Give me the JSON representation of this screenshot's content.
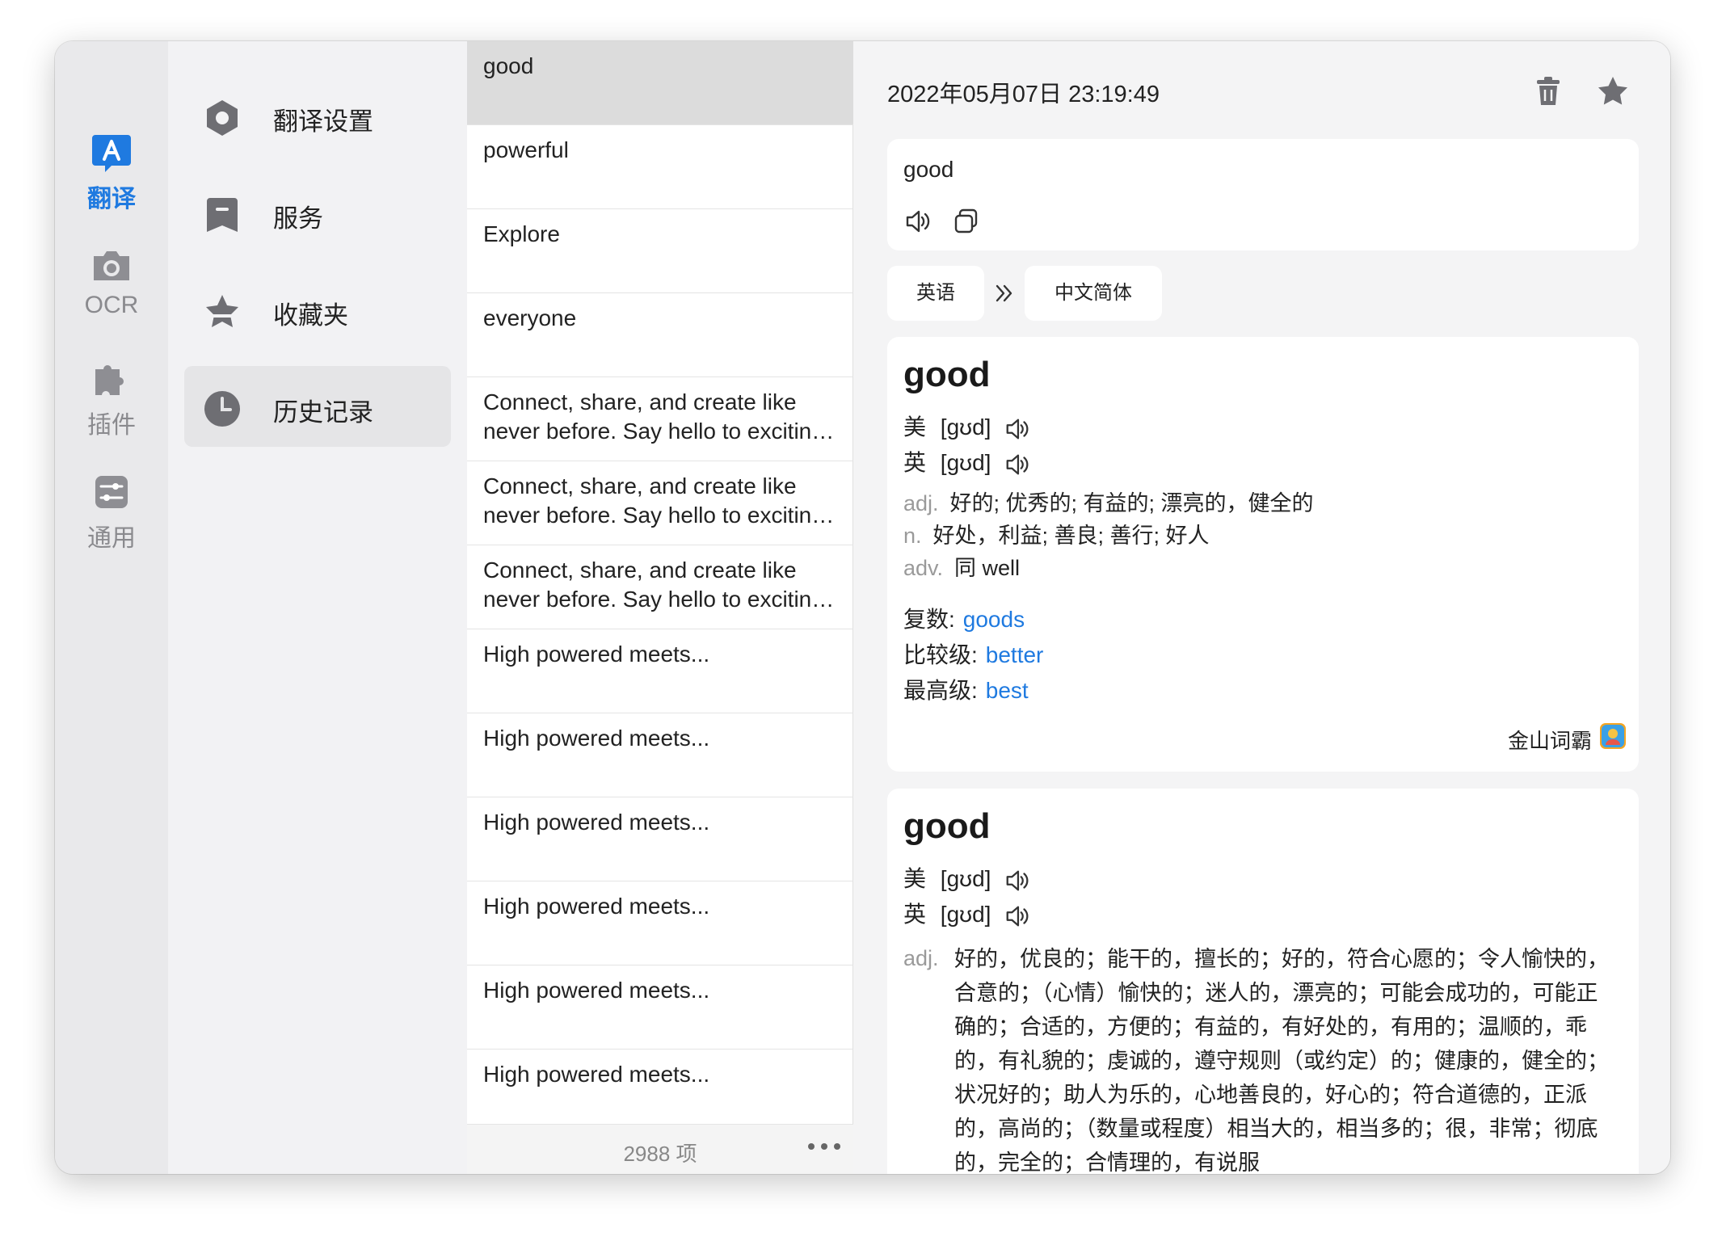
{
  "window": {
    "rail": [
      {
        "label": "翻译",
        "icon": "translate-icon",
        "active": true
      },
      {
        "label": "OCR",
        "icon": "camera-icon",
        "active": false
      },
      {
        "label": "插件",
        "icon": "puzzle-icon",
        "active": false
      },
      {
        "label": "通用",
        "icon": "sliders-icon",
        "active": false
      }
    ],
    "menu": [
      {
        "label": "翻译设置",
        "icon": "settings-ring-icon"
      },
      {
        "label": "服务",
        "icon": "service-icon"
      },
      {
        "label": "收藏夹",
        "icon": "star-badge-icon"
      },
      {
        "label": "历史记录",
        "icon": "clock-icon",
        "active": true
      }
    ]
  },
  "history": {
    "items": [
      "good",
      "powerful",
      "Explore",
      "everyone",
      "Connect, share, and create like never before. Say hello to exciting new features",
      "Connect, share, and create like never before. Say hello to exciting new features",
      "Connect, share, and create like never before. Say hello to exciting new features",
      "High powered meets...",
      "High powered meets...",
      "High powered meets...",
      "High powered meets...",
      "High powered meets...",
      "High powered meets..."
    ],
    "count": "2988 项"
  },
  "detail": {
    "timestamp": "2022年05月07日 23:19:49",
    "source_text": "good",
    "from_lang": "英语",
    "to_lang": "中文简体",
    "results": [
      {
        "word": "good",
        "us_label": "美",
        "us_phonetic": "[ɡʊd]",
        "uk_label": "英",
        "uk_phonetic": "[ɡʊd]",
        "defs": [
          {
            "pos": "adj.",
            "text": "好的; 优秀的; 有益的; 漂亮的，健全的"
          },
          {
            "pos": "n.",
            "text": "好处，利益; 善良; 善行; 好人"
          },
          {
            "pos": "adv.",
            "text": "同 well"
          }
        ],
        "forms": [
          {
            "label": "复数:",
            "value": "goods"
          },
          {
            "label": "比较级:",
            "value": "better"
          },
          {
            "label": "最高级:",
            "value": "best"
          }
        ],
        "service": "金山词霸"
      },
      {
        "word": "good",
        "us_label": "美",
        "us_phonetic": "[ɡʊd]",
        "uk_label": "英",
        "uk_phonetic": "[ɡʊd]",
        "adj_pos": "adj.",
        "adj_text": "好的，优良的；能干的，擅长的；好的，符合心愿的；令人愉快的，合意的；（心情）愉快的；迷人的，漂亮的；可能会成功的，可能正确的；合适的，方便的；有益的，有好处的，有用的；温顺的，乖的，有礼貌的；虔诚的，遵守规则（或约定）的；健康的，健全的；状况好的；助人为乐的，心地善良的，好心的；符合道德的，正派的，高尚的；（数量或程度）相当大的，相当多的；很，非常；彻底的，完全的；合情理的，有说服"
      }
    ]
  },
  "colors": {
    "accent": "#1f7ae0",
    "selected_row": "#dcdcdc"
  }
}
